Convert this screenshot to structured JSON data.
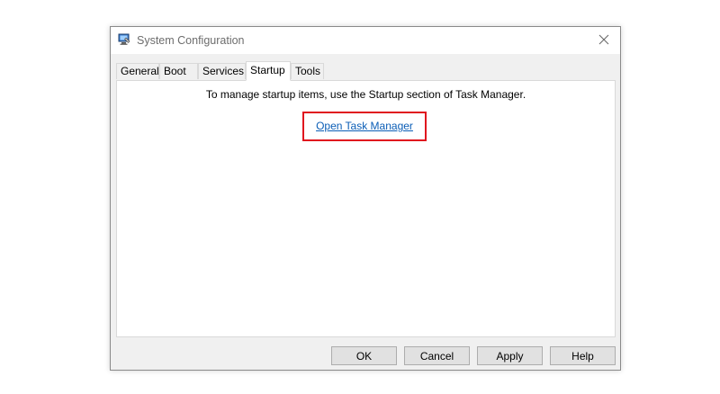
{
  "window": {
    "title": "System Configuration",
    "icon": "msconfig-icon",
    "close_icon": "close-icon"
  },
  "tabs": [
    {
      "label": "General",
      "active": false
    },
    {
      "label": "Boot",
      "active": false
    },
    {
      "label": "Services",
      "active": false
    },
    {
      "label": "Startup",
      "active": true
    },
    {
      "label": "Tools",
      "active": false
    }
  ],
  "startup": {
    "message": "To manage startup items, use the Startup section of Task Manager.",
    "link_label": "Open Task Manager",
    "highlight_color": "#e0141e",
    "link_color": "#0a5db6"
  },
  "buttons": {
    "ok": "OK",
    "cancel": "Cancel",
    "apply": "Apply",
    "help": "Help"
  }
}
